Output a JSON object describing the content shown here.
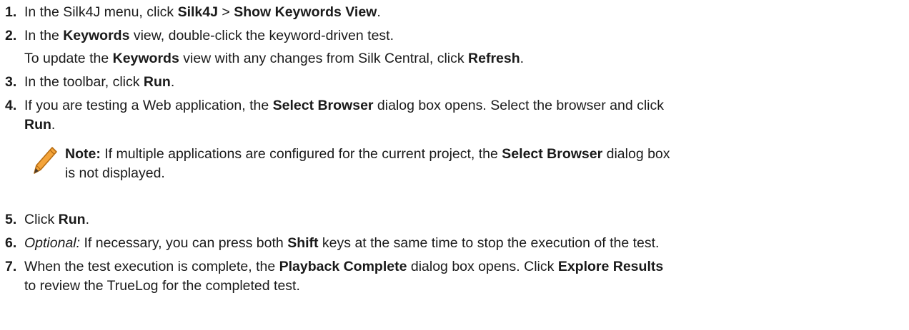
{
  "steps": [
    {
      "num": "1.",
      "a": "In the Silk4J menu, click ",
      "b": "Silk4J",
      "c": " > ",
      "d": "Show Keywords View",
      "e": "."
    },
    {
      "num": "2.",
      "a": "In the ",
      "b": "Keywords",
      "c": " view, double-click the keyword-driven test."
    },
    {
      "sub_a": "To update the ",
      "sub_b": "Keywords",
      "sub_c": " view with any changes from Silk Central, click ",
      "sub_d": "Refresh",
      "sub_e": "."
    },
    {
      "num": "3.",
      "a": "In the toolbar, click ",
      "b": "Run",
      "c": "."
    },
    {
      "num": "4.",
      "a": "If you are testing a Web application, the ",
      "b": "Select Browser",
      "c": " dialog box opens. Select the browser and click",
      "d": "Run",
      "e": "."
    },
    {
      "num": "5.",
      "a": "Click ",
      "b": "Run",
      "c": "."
    },
    {
      "num": "6.",
      "a": "Optional:",
      "b": " If necessary, you can press both ",
      "c": "Shift",
      "d": " keys at the same time to stop the execution of the test."
    },
    {
      "num": "7.",
      "a": "When the test execution is complete, the ",
      "b": "Playback Complete",
      "c": " dialog box opens. Click ",
      "d": "Explore Results",
      "e": "to review the TrueLog for the completed test."
    }
  ],
  "note": {
    "label": "Note:",
    "a": " If multiple applications are configured for the current project, the ",
    "b": "Select Browser",
    "c": " dialog box",
    "d": "is not displayed."
  },
  "colors": {
    "pencil": "#f0a030",
    "text": "#1a1a1a"
  },
  "icons": {
    "note": "pencil-icon"
  }
}
